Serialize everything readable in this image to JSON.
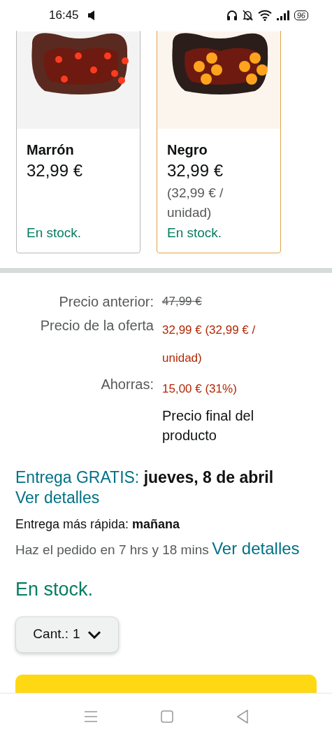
{
  "status_bar": {
    "time": "16:45",
    "battery": "96"
  },
  "variants": [
    {
      "name": "Marrón",
      "price": "32,99 €",
      "stock": "En stock.",
      "selected": false
    },
    {
      "name": "Negro",
      "price": "32,99 €",
      "unit_price": "(32,99 € / unidad)",
      "stock": "En stock.",
      "selected": true
    }
  ],
  "price_rows": [
    {
      "label": "Precio anterior:",
      "value": "47,99 €",
      "kind": "strike"
    },
    {
      "label": "Precio de la oferta",
      "value": "32,99 € (32,99 € / unidad)",
      "kind": "deal"
    },
    {
      "label": "Ahorras:",
      "value": "15,00 € (31%)",
      "kind": "deal"
    },
    {
      "value": "Precio final del producto",
      "kind": "note"
    }
  ],
  "delivery": {
    "label": "Entrega GRATIS:",
    "date": "jueves, 8 de abril",
    "link": "Ver detalles"
  },
  "fastest": "Entrega más rápida: **mañana**",
  "order_by": {
    "text": "Haz el pedido en 7 hrs y 18 mins",
    "link": "Ver detalles"
  },
  "stock": "En stock.",
  "quantity": {
    "label": "Cant.:",
    "value": "1"
  }
}
